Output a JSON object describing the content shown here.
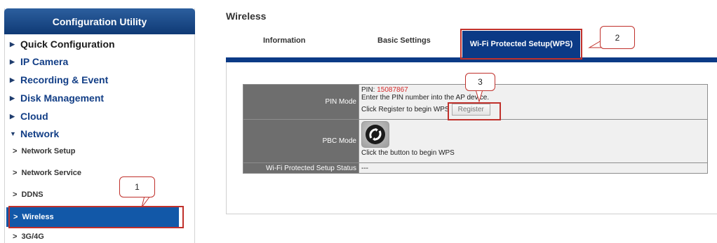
{
  "sidebar": {
    "title": "Configuration Utility",
    "items": [
      {
        "label": "Quick Configuration",
        "arrow": "▶"
      },
      {
        "label": "IP Camera",
        "arrow": "▶"
      },
      {
        "label": "Recording & Event",
        "arrow": "▶"
      },
      {
        "label": "Disk Management",
        "arrow": "▶"
      },
      {
        "label": "Cloud",
        "arrow": "▶"
      },
      {
        "label": "Network",
        "arrow": "▼"
      }
    ],
    "sub_items": [
      {
        "label": "Network Setup"
      },
      {
        "label": "Network Service"
      },
      {
        "label": "DDNS"
      },
      {
        "label": "Wireless",
        "active": true
      },
      {
        "label": "3G/4G"
      }
    ],
    "sub_prefix": ">"
  },
  "main": {
    "title": "Wireless",
    "tabs": [
      {
        "label": "Information"
      },
      {
        "label": "Basic Settings"
      },
      {
        "label": "Wi-Fi Protected Setup(WPS)",
        "active": true
      }
    ]
  },
  "wps": {
    "pin_mode_label": "PIN Mode",
    "pin_prefix": "PIN:",
    "pin_value": "15087867",
    "pin_instruction": "Enter the PIN number into the AP device.",
    "register_instruction": "Click Register to begin WPS",
    "register_button": "Register",
    "pbc_mode_label": "PBC Mode",
    "pbc_instruction": "Click the button to begin WPS",
    "status_label": "Wi-Fi Protected Setup Status",
    "status_value": "---"
  },
  "annotations": [
    "1",
    "2",
    "3"
  ],
  "colors": {
    "primary_blue": "#0b3a86",
    "highlight_red": "#c0302b",
    "pin_red": "#d62a2a"
  }
}
